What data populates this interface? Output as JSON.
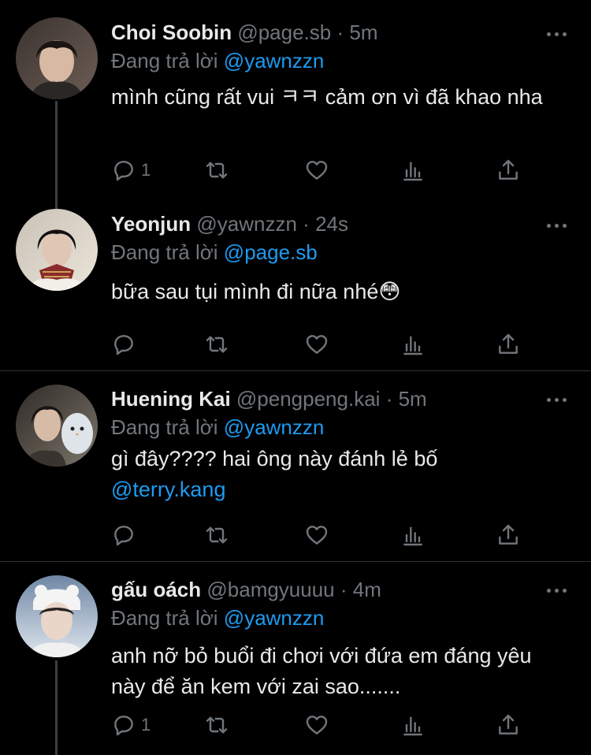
{
  "tweets": [
    {
      "name": "Choi Soobin",
      "handle": "@page.sb",
      "time": "5m",
      "reply_prefix": "Đang trả lời",
      "reply_to": "@yawnzzn",
      "text": "mình cũng rất vui ㅋㅋ cảm ơn vì đã khao nha",
      "text_mention": "",
      "reply_count": "1",
      "colors": {
        "bg1": "#3b3330",
        "bg2": "#6d5e55",
        "skin": "#d8b9a4",
        "hair": "#1c1412"
      }
    },
    {
      "name": "Yeonjun",
      "handle": "@yawnzzn",
      "time": "24s",
      "reply_prefix": "Đang trả lời",
      "reply_to": "@page.sb",
      "text": "bữa sau tụi mình đi nữa nhé😳",
      "text_mention": "",
      "reply_count": "",
      "colors": {
        "bg1": "#c9c1b5",
        "bg2": "#ebe5da",
        "skin": "#e0c7b5",
        "hair": "#121010"
      }
    },
    {
      "name": "Huening Kai",
      "handle": "@pengpeng.kai",
      "time": "5m",
      "reply_prefix": "Đang trả lời",
      "reply_to": "@yawnzzn",
      "text": "gì đây???? hai ông này đánh lẻ bố",
      "text_mention": "@terry.kang",
      "reply_count": "",
      "colors": {
        "bg1": "#2e2a26",
        "bg2": "#7e766c",
        "skin": "#d6bba6",
        "hair": "#1a1512"
      }
    },
    {
      "name": "gấu oách",
      "handle": "@bamgyuuuu",
      "time": "4m",
      "reply_prefix": "Đang trả lời",
      "reply_to": "@yawnzzn",
      "text": "anh nỡ bỏ buổi đi chơi với đứa em đáng yêu này để ăn kem với zai sao.......",
      "text_mention": "",
      "reply_count": "1",
      "colors": {
        "bg1": "#6f87a5",
        "bg2": "#dfe6ee",
        "skin": "#e9d6c8",
        "hair": "#2a2422"
      }
    }
  ],
  "icons": {
    "reply": "reply-icon",
    "retweet": "retweet-icon",
    "like": "heart-icon",
    "views": "views-icon",
    "share": "share-icon",
    "more": "more-icon"
  },
  "theme": {
    "background": "#000000",
    "text": "#e7e9ea",
    "muted": "#71767b",
    "link": "#1d9bf0",
    "divider": "#2f3336",
    "thread_line": "#3a3f44"
  }
}
